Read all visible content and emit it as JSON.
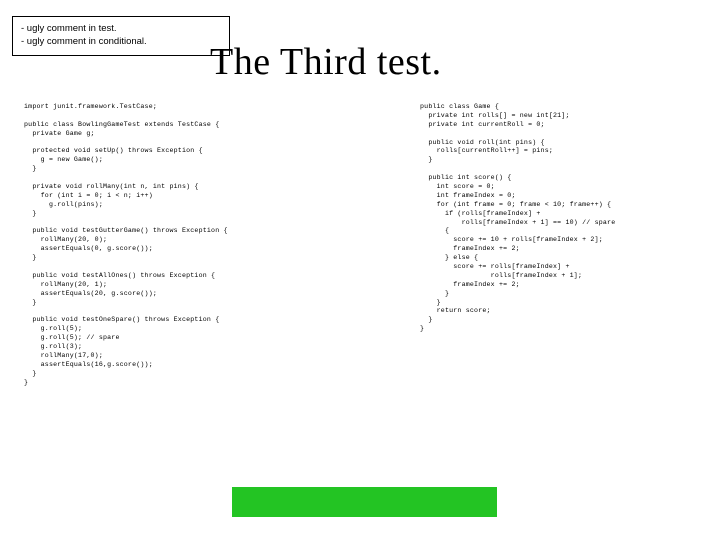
{
  "notes": {
    "line1": "- ugly comment in test.",
    "line2": "- ugly comment in conditional."
  },
  "title": "The Third test.",
  "code_left": "import junit.framework.TestCase;\n\npublic class BowlingGameTest extends TestCase {\n  private Game g;\n\n  protected void setUp() throws Exception {\n    g = new Game();\n  }\n\n  private void rollMany(int n, int pins) {\n    for (int i = 0; i < n; i++)\n      g.roll(pins);\n  }\n\n  public void testGutterGame() throws Exception {\n    rollMany(20, 0);\n    assertEquals(0, g.score());\n  }\n\n  public void testAllOnes() throws Exception {\n    rollMany(20, 1);\n    assertEquals(20, g.score());\n  }\n\n  public void testOneSpare() throws Exception {\n    g.roll(5);\n    g.roll(5); // spare\n    g.roll(3);\n    rollMany(17,0);\n    assertEquals(16,g.score());\n  }\n}",
  "code_right": "public class Game {\n  private int rolls[] = new int[21];\n  private int currentRoll = 0;\n\n  public void roll(int pins) {\n    rolls[currentRoll++] = pins;\n  }\n\n  public int score() {\n    int score = 0;\n    int frameIndex = 0;\n    for (int frame = 0; frame < 10; frame++) {\n      if (rolls[frameIndex] +\n          rolls[frameIndex + 1] == 10) // spare\n      {\n        score += 10 + rolls[frameIndex + 2];\n        frameIndex += 2;\n      } else {\n        score += rolls[frameIndex] +\n                 rolls[frameIndex + 1];\n        frameIndex += 2;\n      }\n    }\n    return score;\n  }\n}"
}
